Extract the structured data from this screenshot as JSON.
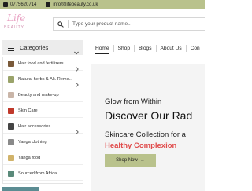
{
  "topbar": {
    "phone": "0775620714",
    "email": "info@lifebeauty.co.uk"
  },
  "logo": {
    "script": "Life",
    "word": "BEAUTY"
  },
  "search": {
    "placeholder": "Type your product name.."
  },
  "categories": {
    "title": "Categories",
    "items": [
      {
        "label": "Hair food and fertilizers",
        "has_submenu": true,
        "thumb_color": "#7a5a3a"
      },
      {
        "label": "Natural herbs & Alt. Reme...",
        "has_submenu": true,
        "thumb_color": "#9aa36a"
      },
      {
        "label": "Beauty and make-up",
        "has_submenu": false,
        "thumb_color": "#c9b5a8"
      },
      {
        "label": "Skin Care",
        "has_submenu": false,
        "thumb_color": "#c0392b"
      },
      {
        "label": "Hair accessories",
        "has_submenu": true,
        "thumb_color": "#444444"
      },
      {
        "label": "Yanga clothing",
        "has_submenu": false,
        "thumb_color": "#8a8a8a"
      },
      {
        "label": "Yanga food",
        "has_submenu": false,
        "thumb_color": "#d1b36a"
      },
      {
        "label": "Sourced from Africa",
        "has_submenu": false,
        "thumb_color": "#5a8a7a"
      }
    ]
  },
  "nav": {
    "items": [
      "Home",
      "Shop",
      "Blogs",
      "About Us",
      "Con"
    ]
  },
  "hero": {
    "line1": "Glow from Within",
    "line2": "Discover Our Rad",
    "line3": "Skincare Collection for a",
    "line4": "Healthy Complexion",
    "button": "Shop Now",
    "button_arrow": "→"
  },
  "colors": {
    "accent": "#b9c28c",
    "highlight": "#e04a4a",
    "bottom_bar": "#5b8c92"
  }
}
